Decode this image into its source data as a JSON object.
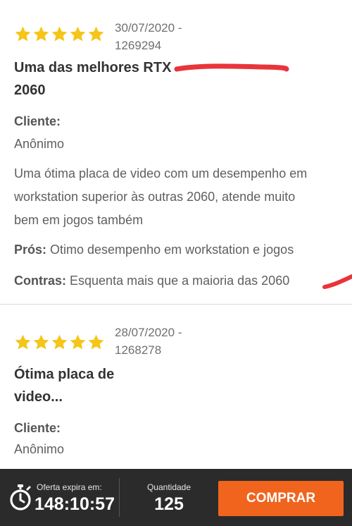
{
  "reviews": [
    {
      "rating": 5,
      "date_line": "30/07/2020 -",
      "id_line": "1269294",
      "title_line1": "Uma das melhores RTX",
      "title_line2": "2060",
      "client_label": "Cliente:",
      "client_name": "Anônimo",
      "body_lines": [
        "Uma ótima placa de video com um desempenho em",
        "workstation superior às outras 2060, atende muito",
        "bem em jogos também"
      ],
      "pros_label": "Prós:",
      "pros_text": " Otimo desempenho em workstation e jogos",
      "cons_label": "Contras:",
      "cons_text": " Esquenta mais que a maioria das 2060"
    },
    {
      "rating": 5,
      "date_line": "28/07/2020 -",
      "id_line": "1268278",
      "title_line1": "Ótima placa de",
      "title_line2": "video...",
      "client_label": "Cliente:",
      "client_name": "Anônimo"
    }
  ],
  "bottom_bar": {
    "offer_label": "Oferta expira em:",
    "offer_time": "148:10:57",
    "quantity_label": "Quantidade",
    "quantity_value": "125",
    "buy_label": "COMPRAR"
  },
  "colors": {
    "star": "#f5c518",
    "buy_button": "#f0641e",
    "bottom_bar": "#2b2b2b",
    "scribble": "#e8343a"
  },
  "icons": {
    "star": "star-icon",
    "timer": "stopwatch-icon"
  }
}
